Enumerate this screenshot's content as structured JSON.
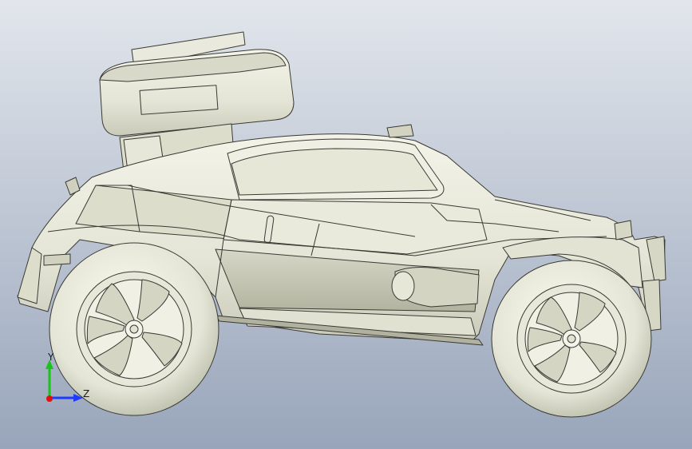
{
  "viewport": {
    "background_top": "#dfe3ea",
    "background_bottom": "#9aa6ba"
  },
  "model": {
    "name": "",
    "body_color": "#e8e9dc",
    "edge_color": "#3a3a34"
  },
  "axis_triad": {
    "y_label": "Y",
    "z_label": "Z",
    "y_color": "#19c319",
    "z_color": "#1e3cff",
    "x_color": "#e01010"
  }
}
